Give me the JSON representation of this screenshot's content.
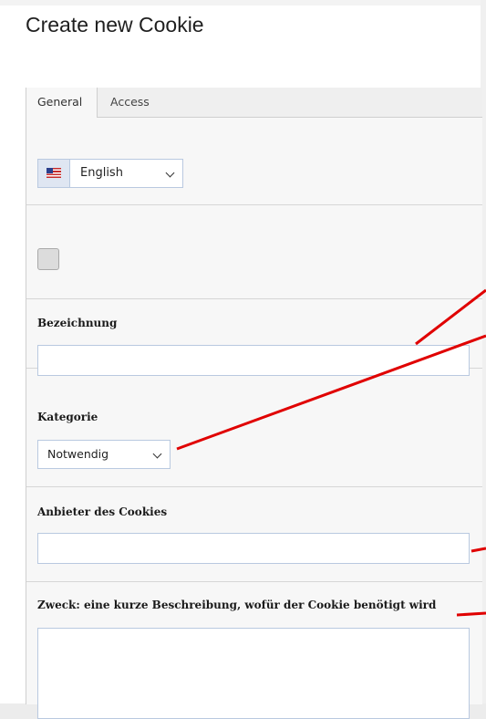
{
  "page": {
    "title": "Create new Cookie"
  },
  "tabs": [
    {
      "label": "General",
      "active": true
    },
    {
      "label": "Access",
      "active": false
    }
  ],
  "language": {
    "selected": "English",
    "flag_icon": "us-flag-icon"
  },
  "fields": {
    "bezeichnung": {
      "label": "Bezeichnung",
      "value": ""
    },
    "kategorie": {
      "label": "Kategorie",
      "selected": "Notwendig"
    },
    "anbieter": {
      "label": "Anbieter des Cookies",
      "value": ""
    },
    "zweck": {
      "label": "Zweck: eine kurze Beschreibung, wofür der Cookie benötigt wird",
      "value": ""
    }
  },
  "colors": {
    "annotation": "#e00000",
    "input_border": "#b9c9e0"
  }
}
